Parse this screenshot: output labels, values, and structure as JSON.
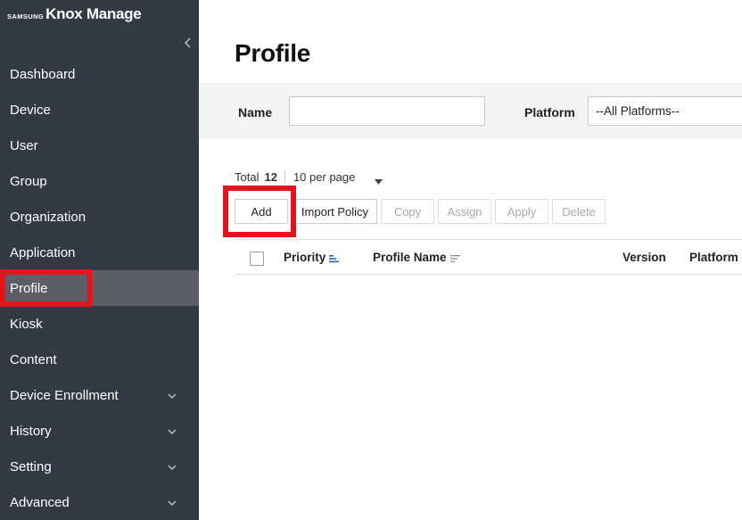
{
  "brand": {
    "company": "SAMSUNG",
    "product": "Knox Manage"
  },
  "sidebar": {
    "items": [
      {
        "label": "Dashboard"
      },
      {
        "label": "Device"
      },
      {
        "label": "User"
      },
      {
        "label": "Group"
      },
      {
        "label": "Organization"
      },
      {
        "label": "Application"
      },
      {
        "label": "Profile",
        "active": true
      },
      {
        "label": "Kiosk"
      },
      {
        "label": "Content"
      },
      {
        "label": "Device Enrollment",
        "expandable": true
      },
      {
        "label": "History",
        "expandable": true
      },
      {
        "label": "Setting",
        "expandable": true
      },
      {
        "label": "Advanced",
        "expandable": true
      }
    ]
  },
  "page": {
    "title": "Profile"
  },
  "filters": {
    "name_label": "Name",
    "name_value": "",
    "platform_label": "Platform",
    "platform_value": "--All Platforms--"
  },
  "list": {
    "total_label": "Total",
    "total_count": "12",
    "per_page": "10 per page"
  },
  "toolbar": {
    "add": "Add",
    "import_policy": "Import Policy",
    "copy": "Copy",
    "assign": "Assign",
    "apply": "Apply",
    "delete": "Delete"
  },
  "table": {
    "columns": [
      "Priority",
      "Profile Name",
      "Version",
      "Platform"
    ]
  },
  "colors": {
    "sidebar_bg": "#343a45",
    "active_item_bg": "#5c5f65",
    "highlight": "#e2151f",
    "filter_bg": "#f2f3f5",
    "sort_active": "#1a5fb4"
  }
}
